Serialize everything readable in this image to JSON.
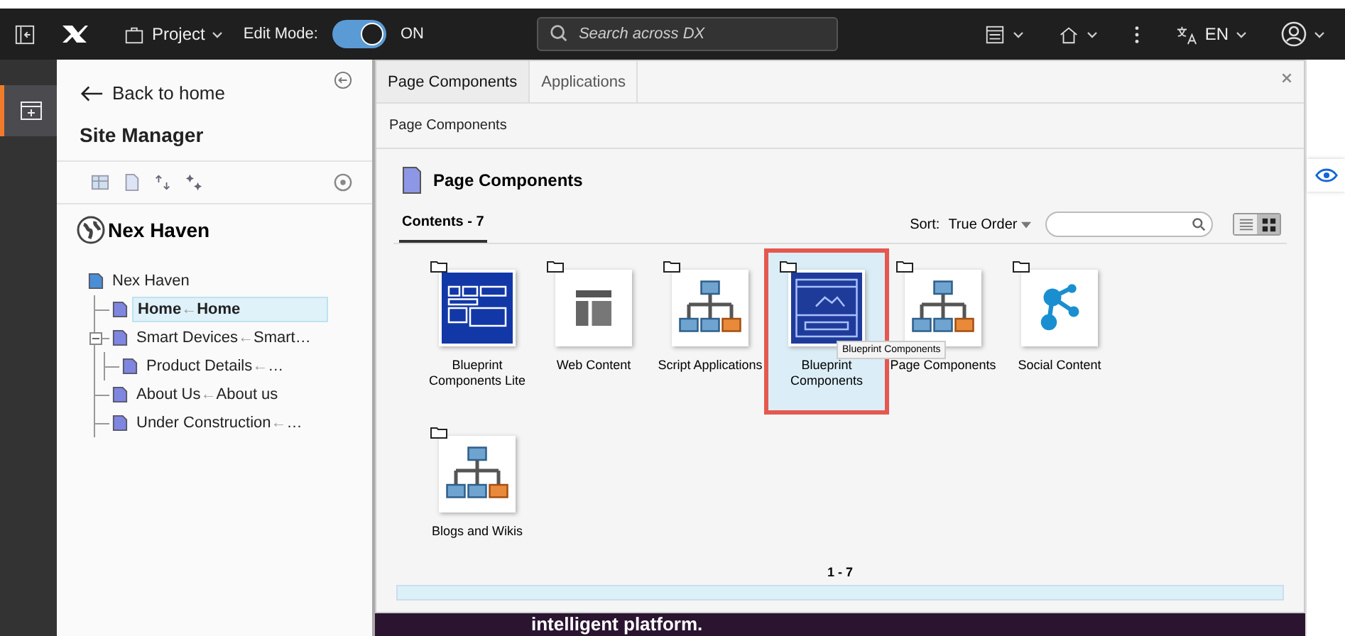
{
  "topbar": {
    "project": "Project",
    "edit_mode_label": "Edit Mode:",
    "edit_mode": {
      "on": true,
      "label": "ON"
    },
    "search_placeholder": "Search across DX",
    "language": "EN"
  },
  "sidebar": {
    "back": "Back to home",
    "title": "Site Manager",
    "site_name": "Nex Haven",
    "tree": {
      "label": "Nex Haven",
      "children": [
        {
          "label": "Home",
          "arrow": "←",
          "target": "Home",
          "selected": true
        },
        {
          "label": "Smart Devices",
          "arrow": "←",
          "target": "Smart…",
          "selected": false,
          "expanded": true,
          "children": [
            {
              "label": "Product Details",
              "arrow": "←",
              "target": "…",
              "selected": false
            }
          ]
        },
        {
          "label": "About Us",
          "arrow": "←",
          "target": "About us",
          "selected": false
        },
        {
          "label": "Under Construction",
          "arrow": "←",
          "target": "…",
          "selected": false
        }
      ]
    }
  },
  "dialog": {
    "tabs": [
      {
        "label": "Page Components",
        "selected": true
      },
      {
        "label": "Applications",
        "selected": false
      }
    ],
    "breadcrumb": "Page Components",
    "heading": "Page Components",
    "contents_tab": "Contents - 7",
    "sort_label": "Sort:",
    "sort_value": "True Order",
    "views": [
      {
        "kind": "list",
        "selected": false
      },
      {
        "kind": "grid",
        "selected": true
      }
    ],
    "items": [
      {
        "label": "Blueprint Components Lite",
        "kind": "blueprint-lite",
        "selected": false
      },
      {
        "label": "Web Content",
        "kind": "layout",
        "selected": false
      },
      {
        "label": "Script Applications",
        "kind": "hierarchy",
        "selected": false
      },
      {
        "label": "Blueprint Components",
        "kind": "blueprint",
        "selected": true,
        "tooltip": "Blueprint Components"
      },
      {
        "label": "Page Components",
        "kind": "hierarchy",
        "selected": false
      },
      {
        "label": "Social Content",
        "kind": "social",
        "selected": false
      },
      {
        "label": "Blogs and Wikis",
        "kind": "hierarchy",
        "selected": false
      }
    ],
    "pager": "1 - 7"
  },
  "background": {
    "hero_text": "intelligent platform."
  }
}
